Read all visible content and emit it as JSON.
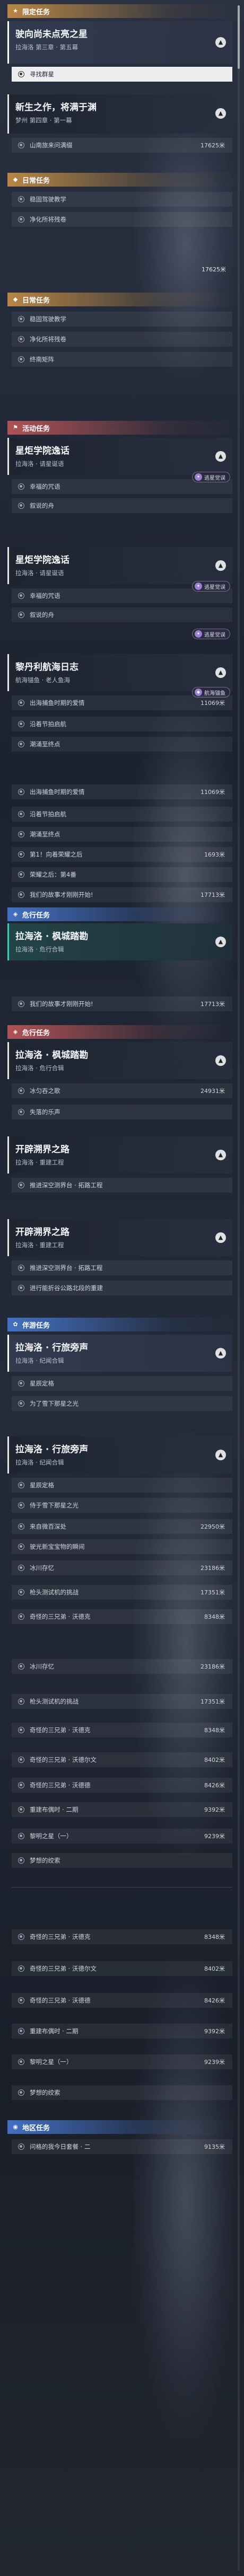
{
  "sections": {
    "trial": "限定任务",
    "daily": "日常任务",
    "event": "活动任务",
    "adventure": "危行任务",
    "companion": "伴游任务",
    "explore": "游历任务",
    "world": "地区任务"
  },
  "cards": {
    "c1": {
      "title": "驶向尚未点亮之星",
      "sub": "拉海洛 第三章 · 第五幕"
    },
    "c2": {
      "title": "新生之作，将满于渊",
      "sub": "梦州 第四章 · 第一幕"
    },
    "c3": {
      "title": "星炬学院逸话",
      "sub": "拉海洛 · 请星诞语"
    },
    "c4": {
      "title": "星炬学院逸话",
      "sub": "拉海洛 · 请星诞语"
    },
    "c5": {
      "title": "黎丹利航海日志",
      "sub": "航海锚鱼 · 老人鱼海"
    },
    "c6": {
      "title": "拉海洛 · 枫城踏勘",
      "sub": "拉海洛 · 危行合辑"
    },
    "c7": {
      "title": "拉海洛 · 枫城踏勘",
      "sub": "拉海洛 · 危行合辑"
    },
    "c8": {
      "title": "开辟溯界之路",
      "sub": "拉海洛 · 重建工程"
    },
    "c9": {
      "title": "开辟溯界之路",
      "sub": "拉海洛 · 重建工程"
    },
    "c10": {
      "title": "拉海洛 · 行旅旁声",
      "sub": "拉海洛 · 纪闻合辑"
    },
    "c11": {
      "title": "拉海洛 · 行旅旁声",
      "sub": "拉海洛 · 纪闻合辑"
    }
  },
  "tasks": {
    "t1": "寻找群星",
    "t2": "山南旅来问满缀",
    "t3": "稳固驾驶教学",
    "t4": "净化所将残卷",
    "t5": "稳固驾驶教学",
    "t6": "净化所将残卷",
    "t7": "终南矩阵",
    "t8": "幸福的咒语",
    "t9": "叙说的舟",
    "t10": "幸福的咒语",
    "t11": "叙说的舟",
    "t12": "出海捕鱼时期的爱情",
    "t13": "沿着节拍启航",
    "t14": "潮涌至终点",
    "t15": "出海捕鱼时期的爱情",
    "t16": "沿着节拍启航",
    "t17": "潮涌至终点",
    "t18": "第1！向着荣耀之后",
    "t19": "荣耀之后：第4番",
    "t20": "我们的故事才刚刚开始!",
    "t21": "我们的故事才刚刚开始!",
    "t22": "冰匀吞之歌",
    "t23": "失落的乐声",
    "t24": "推进深空测界台 · 拓路工程",
    "t25": "推进深空测界台 · 拓路工程",
    "t26": "进行能折谷公路北段的重建",
    "t27": "星辰定格",
    "t28": "为了雪下那星之光",
    "t29": "星辰定格",
    "t30": "侍于雪下那星之光",
    "t31": "来自微百深处",
    "t32": "驶光新宝宝物的瞬间",
    "t33": "冰川存忆",
    "t34": "枪头测试机的挑战",
    "t35": "奇怪的三兄弟 · 沃德克",
    "t36": "冰川存忆",
    "t37": "枪头测试机的挑战",
    "t38": "奇怪的三兄弟 · 沃德克",
    "t39": "奇怪的三兄弟 · 沃德尔文",
    "t40": "奇怪的三兄弟 · 沃德德",
    "t41": "重建布偶时 · 二期",
    "t42": "黎明之星（一）",
    "t43": "梦想的绞索",
    "t44": "奇怪的三兄弟 · 沃德克",
    "t45": "奇怪的三兄弟 · 沃德尔文",
    "t46": "奇怪的三兄弟 · 沃德德",
    "t47": "重建布偶时 · 二期",
    "t48": "黎明之星（一）",
    "t49": "梦想的绞索",
    "t50": "问格的我今日套餐 · 二"
  },
  "dist": {
    "d2": "17625米",
    "d3": "17625米",
    "d12": "11069米",
    "d15": "11069米",
    "d18": "1693米",
    "d20": "17713米",
    "d21": "17713米",
    "d22": "24931米",
    "d31": "22950米",
    "d33": "23186米",
    "d34": "17351米",
    "d35": "8348米",
    "d36": "23186米",
    "d37": "17351米",
    "d38": "8348米",
    "d39": "8402米",
    "d40": "8426米",
    "d41": "9392米",
    "d42": "9239米",
    "d44": "8348米",
    "d45": "8402米",
    "d46": "8426米",
    "d47": "9392米",
    "d48": "9239米",
    "d50": "9135米"
  },
  "badges": {
    "b1": "逃星觉误",
    "b2": "逃星觉误",
    "b3": "逃星觉误",
    "b4": "航海锚鱼"
  }
}
